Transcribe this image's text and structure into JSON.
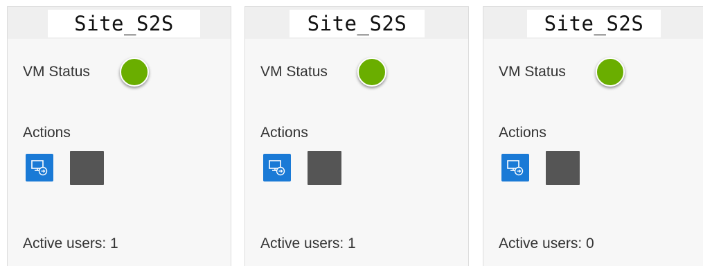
{
  "cards": [
    {
      "title": "Site_S2S",
      "vm_status_label": "VM Status",
      "vm_status_color": "#6aae00",
      "actions_label": "Actions",
      "active_users_label": "Active users: 1"
    },
    {
      "title": "Site_S2S",
      "vm_status_label": "VM Status",
      "vm_status_color": "#6aae00",
      "actions_label": "Actions",
      "active_users_label": "Active users: 1"
    },
    {
      "title": "Site_S2S",
      "vm_status_label": "VM Status",
      "vm_status_color": "#6aae00",
      "actions_label": "Actions",
      "active_users_label": "Active users: 0"
    }
  ],
  "icons": {
    "connect": "remote-desktop-icon",
    "stop": "stop-icon"
  },
  "colors": {
    "status_running": "#6aae00",
    "connect_button": "#1a7ad6",
    "stop_button": "#555555"
  }
}
